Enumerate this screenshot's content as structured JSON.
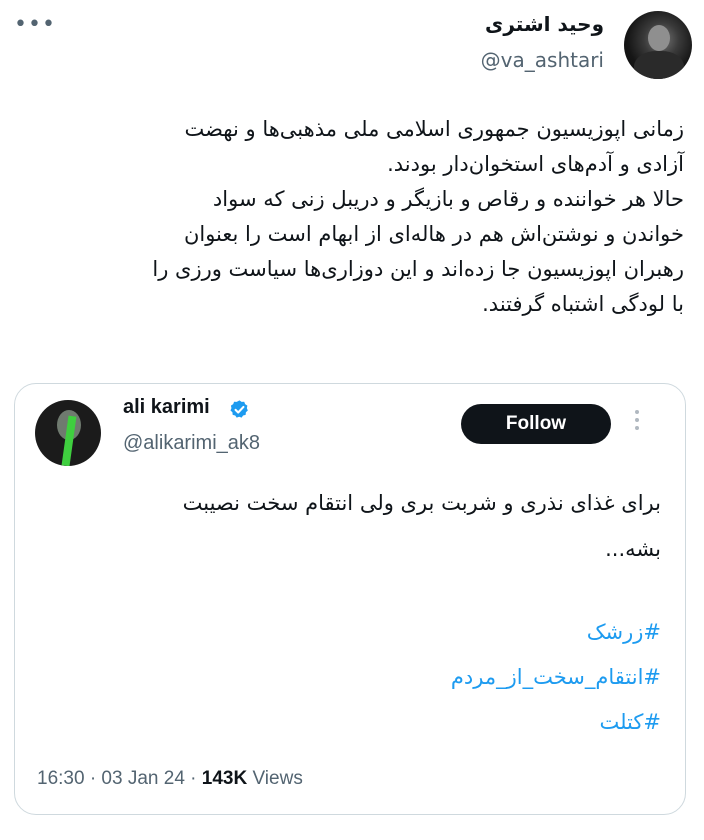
{
  "author": {
    "name": "وحید اشتری",
    "handle": "@va_ashtari"
  },
  "tweet": {
    "lines": [
      "زمانی اپوزیسیون جمهوری اسلامی ملی مذهبی‌ها و نهضت",
      "آزادی و آدم‌های استخوان‌دار بودند.",
      "حالا هر خواننده و رقاص و بازیگر و دریبل زنی که سواد",
      "خواندن و نوشتن‌اش هم در هاله‌ای از ابهام است را بعنوان",
      "رهبران اپوزیسیون جا زده‌اند و این دوزاری‌ها سیاست ورزی را",
      "با لودگی اشتباه گرفتند."
    ]
  },
  "quoted": {
    "name": "ali karimi",
    "handle": "@alikarimi_ak8",
    "follow_label": "Follow",
    "text_lines": [
      "برای غذای نذری و شربت بری ولی انتقام سخت نصیبت",
      "بشه..."
    ],
    "hashtags": [
      "#زرشک",
      "#انتقام_سخت_از_مردم",
      "#کتلت"
    ],
    "time": "16:30 · 03 Jan 24 · ",
    "views_count": "143K",
    "views_label": " Views"
  },
  "colors": {
    "link": "#1d9bf0",
    "verified": "#1d9bf0",
    "follow_bg": "#0f1419",
    "muted": "#536471"
  },
  "icons": {
    "more": "more-horizontal-icon",
    "verified": "verified-badge-icon",
    "quote_more": "more-vertical-icon"
  }
}
